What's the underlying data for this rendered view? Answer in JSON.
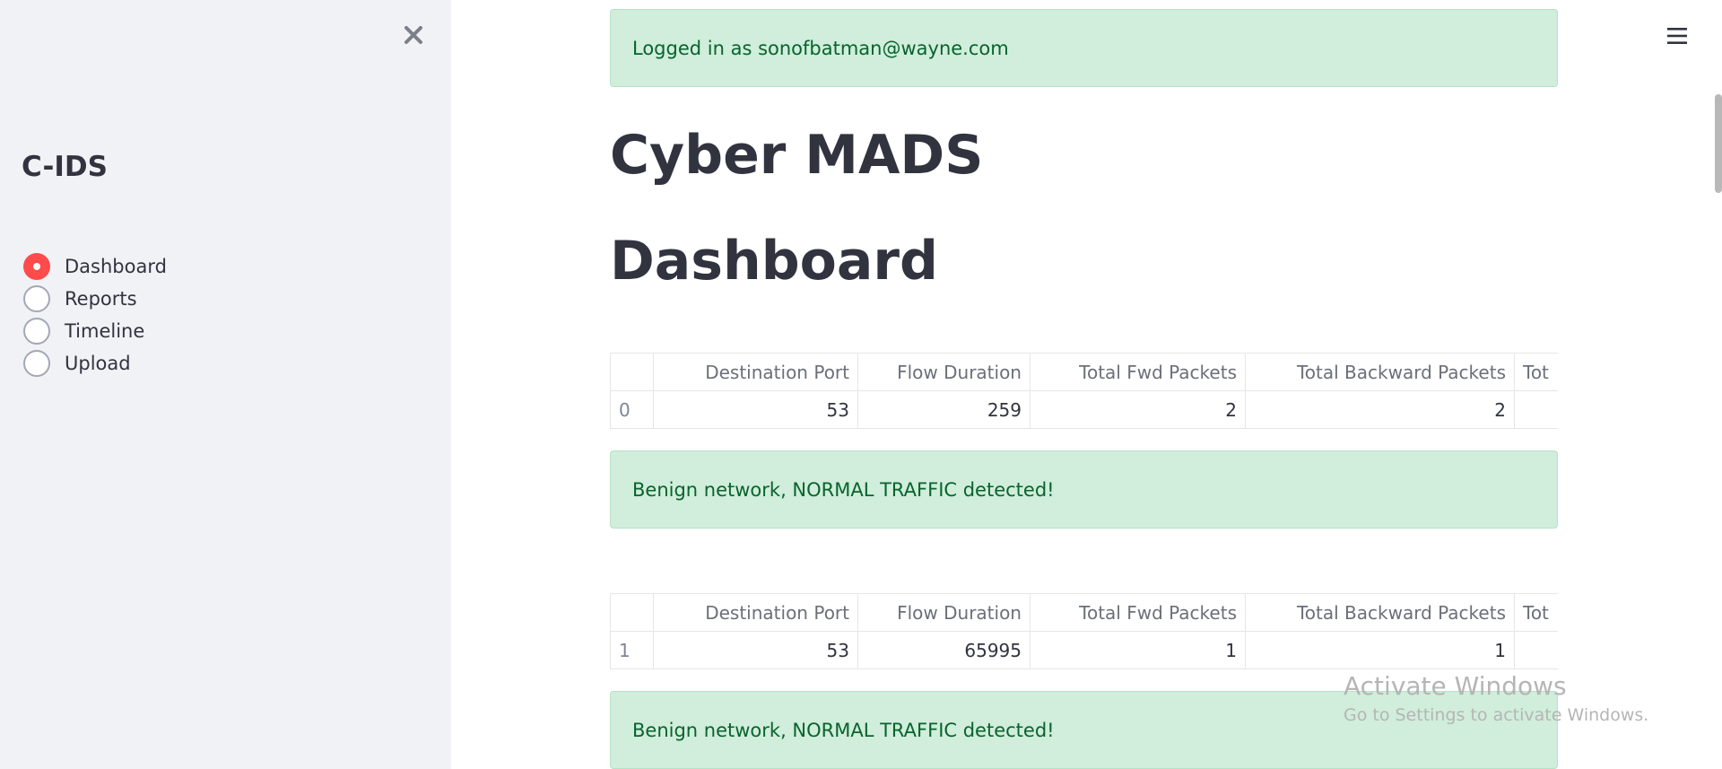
{
  "sidebar": {
    "title": "C-IDS",
    "close_icon": "close-icon",
    "nav": [
      {
        "label": "Dashboard",
        "selected": true
      },
      {
        "label": "Reports",
        "selected": false
      },
      {
        "label": "Timeline",
        "selected": false
      },
      {
        "label": "Upload",
        "selected": false
      }
    ],
    "accent_color": "#ff4b4b"
  },
  "header": {
    "menu_icon": "hamburger-menu-icon"
  },
  "main": {
    "login_status": "Logged in as sonofbatman@wayne.com",
    "app_title": "Cyber MADS",
    "page_title": "Dashboard",
    "table_columns": [
      "",
      "Destination Port",
      "Flow Duration",
      "Total Fwd Packets",
      "Total Backward Packets",
      "Tot"
    ],
    "records": [
      {
        "row": [
          "0",
          "53",
          "259",
          "2",
          "2",
          ""
        ],
        "result": "Benign network, NORMAL TRAFFIC detected!"
      },
      {
        "row": [
          "1",
          "53",
          "65995",
          "1",
          "1",
          ""
        ],
        "result": "Benign network, NORMAL TRAFFIC detected!"
      }
    ],
    "success_bg": "#d0eedb",
    "success_text": "#09632d"
  },
  "watermark": {
    "title": "Activate Windows",
    "subtitle": "Go to Settings to activate Windows."
  }
}
